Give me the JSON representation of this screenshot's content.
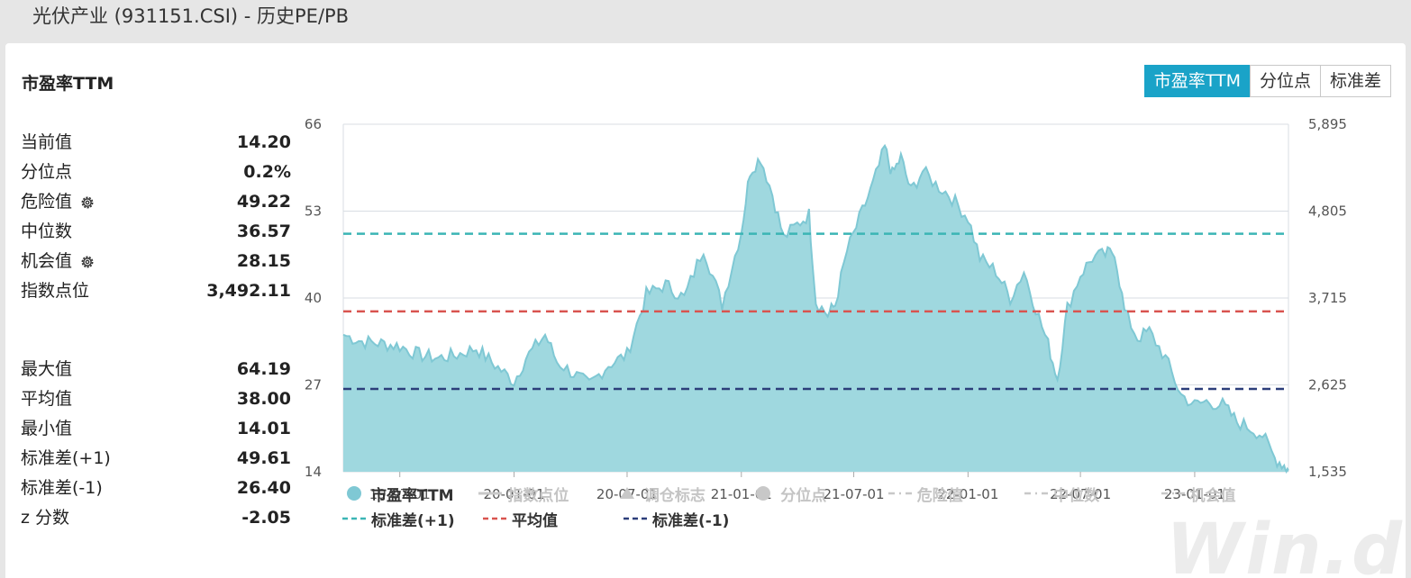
{
  "page": {
    "title": "光伏产业 (931151.CSI) - 历史PE/PB"
  },
  "panel": {
    "title": "市盈率TTM"
  },
  "tabs": [
    {
      "label": "市盈率TTM",
      "active": true
    },
    {
      "label": "分位点",
      "active": false
    },
    {
      "label": "标准差",
      "active": false
    }
  ],
  "stats_top": [
    {
      "label": "当前值",
      "value": "14.20",
      "gear": false
    },
    {
      "label": "分位点",
      "value": "0.2%",
      "gear": false
    },
    {
      "label": "危险值",
      "value": "49.22",
      "gear": true
    },
    {
      "label": "中位数",
      "value": "36.57",
      "gear": false
    },
    {
      "label": "机会值",
      "value": "28.15",
      "gear": true
    },
    {
      "label": "指数点位",
      "value": "3,492.11",
      "gear": false
    }
  ],
  "stats_bottom": [
    {
      "label": "最大值",
      "value": "64.19"
    },
    {
      "label": "平均值",
      "value": "38.00"
    },
    {
      "label": "最小值",
      "value": "14.01"
    },
    {
      "label": "标准差(+1)",
      "value": "49.61"
    },
    {
      "label": "标准差(-1)",
      "value": "26.40"
    },
    {
      "label": "z 分数",
      "value": "-2.05"
    }
  ],
  "legend": {
    "row1": [
      {
        "label": "市盈率TTM",
        "symbol": "circle",
        "color": "#7fc8d4",
        "active": true
      },
      {
        "label": "指数点位",
        "symbol": "line",
        "color": "#c8c8c8",
        "active": false
      },
      {
        "label": "调仓标志",
        "symbol": "triangle",
        "color": "#c8c8c8",
        "active": false
      },
      {
        "label": "分位点",
        "symbol": "circle",
        "color": "#c8c8c8",
        "active": false
      },
      {
        "label": "危险值",
        "symbol": "dashdot",
        "color": "#c8c8c8",
        "active": false
      },
      {
        "label": "中位数",
        "symbol": "dashdot",
        "color": "#c8c8c8",
        "active": false
      },
      {
        "label": "机会值",
        "symbol": "dashdot",
        "color": "#c8c8c8",
        "active": false
      }
    ],
    "row2": [
      {
        "label": "标准差(+1)",
        "symbol": "dash",
        "color": "#3bb5b5",
        "active": true
      },
      {
        "label": "平均值",
        "symbol": "dash",
        "color": "#d9534f",
        "active": true
      },
      {
        "label": "标准差(-1)",
        "symbol": "dash",
        "color": "#2c3e7a",
        "active": true
      }
    ]
  },
  "watermark": "Win.d",
  "colors": {
    "accent": "#1aa3c8",
    "area_fill": "#9fd8df",
    "area_line": "#7fc8d4",
    "grid": "#d8dde3"
  },
  "chart_data": {
    "type": "area",
    "x_ticks": [
      "19-07-01",
      "20-01-01",
      "20-07-01",
      "21-01-01",
      "21-07-01",
      "22-01-01",
      "22-07-01",
      "23-01-01"
    ],
    "y_left_ticks": [
      "66",
      "53",
      "40",
      "27",
      "14"
    ],
    "y_right_ticks": [
      "5,895",
      "4,805",
      "3,715",
      "2,625",
      "1,535"
    ],
    "ylim": [
      14,
      66
    ],
    "y2lim": [
      1535,
      5895
    ],
    "x_range": [
      "2019-04-01",
      "2023-06-01"
    ],
    "grid": true,
    "series": [
      {
        "name": "市盈率TTM",
        "points": [
          [
            "2019-04-01",
            34.5
          ],
          [
            "2019-05-01",
            33.5
          ],
          [
            "2019-06-01",
            33.2
          ],
          [
            "2019-07-01",
            32.8
          ],
          [
            "2019-08-01",
            31.5
          ],
          [
            "2019-09-01",
            31.0
          ],
          [
            "2019-10-01",
            31.5
          ],
          [
            "2019-11-01",
            32.5
          ],
          [
            "2019-12-01",
            30.0
          ],
          [
            "2020-01-01",
            27.5
          ],
          [
            "2020-01-20",
            31.0
          ],
          [
            "2020-02-20",
            34.5
          ],
          [
            "2020-03-10",
            30.5
          ],
          [
            "2020-04-01",
            29.0
          ],
          [
            "2020-05-01",
            27.0
          ],
          [
            "2020-06-01",
            30.0
          ],
          [
            "2020-07-01",
            31.5
          ],
          [
            "2020-08-01",
            40.5
          ],
          [
            "2020-09-01",
            42.0
          ],
          [
            "2020-10-01",
            40.0
          ],
          [
            "2020-11-01",
            47.5
          ],
          [
            "2020-12-01",
            39.0
          ],
          [
            "2021-01-01",
            50.0
          ],
          [
            "2021-01-15",
            59.0
          ],
          [
            "2021-02-01",
            61.0
          ],
          [
            "2021-02-20",
            55.5
          ],
          [
            "2021-03-10",
            49.0
          ],
          [
            "2021-04-01",
            51.0
          ],
          [
            "2021-04-20",
            52.5
          ],
          [
            "2021-05-01",
            39.5
          ],
          [
            "2021-05-20",
            37.5
          ],
          [
            "2021-06-01",
            39.0
          ],
          [
            "2021-06-20",
            47.0
          ],
          [
            "2021-07-15",
            53.0
          ],
          [
            "2021-08-01",
            57.0
          ],
          [
            "2021-08-20",
            62.5
          ],
          [
            "2021-09-01",
            58.5
          ],
          [
            "2021-09-15",
            61.0
          ],
          [
            "2021-10-01",
            56.0
          ],
          [
            "2021-10-20",
            59.0
          ],
          [
            "2021-11-10",
            57.0
          ],
          [
            "2021-12-01",
            55.5
          ],
          [
            "2022-01-01",
            52.0
          ],
          [
            "2022-01-20",
            46.0
          ],
          [
            "2022-02-15",
            44.0
          ],
          [
            "2022-03-10",
            40.0
          ],
          [
            "2022-04-01",
            44.0
          ],
          [
            "2022-04-20",
            38.5
          ],
          [
            "2022-05-10",
            33.0
          ],
          [
            "2022-05-25",
            28.0
          ],
          [
            "2022-06-10",
            38.5
          ],
          [
            "2022-07-01",
            43.5
          ],
          [
            "2022-07-20",
            46.0
          ],
          [
            "2022-08-10",
            46.5
          ],
          [
            "2022-08-25",
            47.0
          ],
          [
            "2022-09-10",
            38.0
          ],
          [
            "2022-10-01",
            34.0
          ],
          [
            "2022-10-20",
            35.0
          ],
          [
            "2022-11-15",
            31.0
          ],
          [
            "2022-12-10",
            25.5
          ],
          [
            "2023-01-01",
            24.0
          ],
          [
            "2023-01-20",
            24.5
          ],
          [
            "2023-02-15",
            24.0
          ],
          [
            "2023-03-10",
            21.5
          ],
          [
            "2023-04-01",
            20.5
          ],
          [
            "2023-04-20",
            19.5
          ],
          [
            "2023-05-10",
            16.0
          ],
          [
            "2023-05-25",
            15.0
          ],
          [
            "2023-06-01",
            14.2
          ]
        ]
      }
    ],
    "reference_lines": [
      {
        "name": "标准差(+1)",
        "value": 49.61,
        "color": "#3bb5b5"
      },
      {
        "name": "平均值",
        "value": 38.0,
        "color": "#d9534f"
      },
      {
        "name": "标准差(-1)",
        "value": 26.4,
        "color": "#2c3e7a"
      }
    ]
  }
}
